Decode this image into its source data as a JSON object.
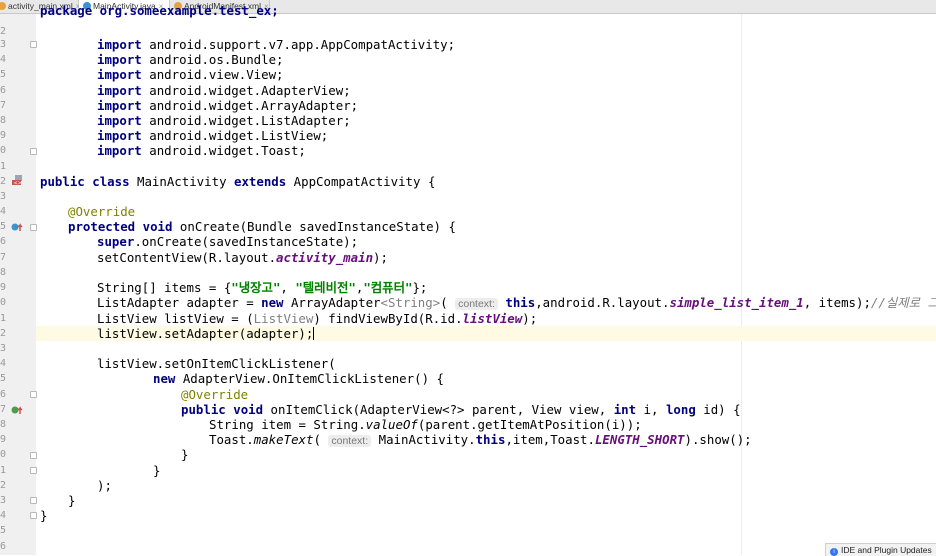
{
  "tabs": [
    {
      "label": "activity_main.xml",
      "close": "×",
      "color": "#e8a23b"
    },
    {
      "label": "MainActivity.java",
      "close": "×",
      "color": "#3a95c9"
    },
    {
      "label": "AndroidManifest.xml",
      "close": "×",
      "color": "#e8a23b"
    }
  ],
  "gutter": {
    "line_numbers": [
      "2",
      "3",
      "4",
      "5",
      "6",
      "7",
      "8",
      "9",
      "0",
      "1",
      "2",
      "3",
      "4",
      "5",
      "6",
      "7",
      "8",
      "9",
      "0",
      "1",
      "2",
      "3",
      "4",
      "5",
      "6",
      "7",
      "8",
      "9",
      "0",
      "1",
      "2",
      "3",
      "4",
      "5",
      "6"
    ]
  },
  "code": {
    "l2": "package org.someexample.test_ex;",
    "imports": [
      "android.support.v7.app.AppCompatActivity;",
      "android.os.Bundle;",
      "android.view.View;",
      "android.widget.AdapterView;",
      "android.widget.ArrayAdapter;",
      "android.widget.ListAdapter;",
      "android.widget.ListView;",
      "android.widget.Toast;"
    ],
    "kw_import": "import",
    "kw_public": "public",
    "kw_class": "class",
    "kw_extends": "extends",
    "kw_protected": "protected",
    "kw_void": "void",
    "kw_super": "super",
    "kw_new": "new",
    "kw_this": "this",
    "kw_int": "int",
    "kw_long": "long",
    "class_name": " MainActivity ",
    "parent_class": " AppCompatActivity {",
    "override": "@Override",
    "oncreate_sig": " onCreate(Bundle savedInstanceState) {",
    "super_call": ".onCreate(savedInstanceState);",
    "setcontent_a": "setContentView(R.layout.",
    "setcontent_field": "activity_main",
    "setcontent_b": ");",
    "items_a": "String[] items = {",
    "items_s1": "\"냉장고\"",
    "items_sep1": ", ",
    "items_s2": "\"텔레비전\"",
    "items_sep2": ",",
    "items_s3": "\"컴퓨터\"",
    "items_b": "};",
    "adapter_a": "ListAdapter adapter = ",
    "adapter_b": " ArrayAdapter",
    "adapter_gen": "<String>",
    "adapter_c": "( ",
    "hint_context": "context:",
    "adapter_d": ",android.R.layout.",
    "adapter_field": "simple_list_item_1",
    "adapter_e": ", items);",
    "adapter_comment": "//실제로 그 리스트",
    "listview_a": "ListView listView = (",
    "listview_cast": "ListView",
    "listview_b": ") findViewById(R.id.",
    "listview_field": "listView",
    "listview_c": ");",
    "setadapter": "listView.setAdapter(adapter);",
    "setlistener": "listView.setOnItemClickListener(",
    "new_listener": " AdapterView.OnItemClickListener() {",
    "onitemclick_a": " onItemClick(AdapterView<?> parent, View view, ",
    "onitemclick_b": " i, ",
    "onitemclick_c": " id) {",
    "item_a": "String item = String.",
    "item_method": "valueOf",
    "item_b": "(parent.getItemAtPosition(i));",
    "toast_a": "Toast.",
    "toast_method": "makeText",
    "toast_b": "( ",
    "toast_c": " MainActivity.",
    "toast_d": ",item,Toast.",
    "toast_field": "LENGTH_SHORT",
    "toast_e": ").show();",
    "close_brace": "}",
    "close_paren": ");"
  },
  "notification": {
    "label": "IDE and Plugin Updates",
    "icon": "info-icon"
  },
  "colors": {
    "keyword": "#000080",
    "string": "#008000",
    "annotation": "#808000",
    "field": "#660e7a",
    "comment": "#808080"
  }
}
